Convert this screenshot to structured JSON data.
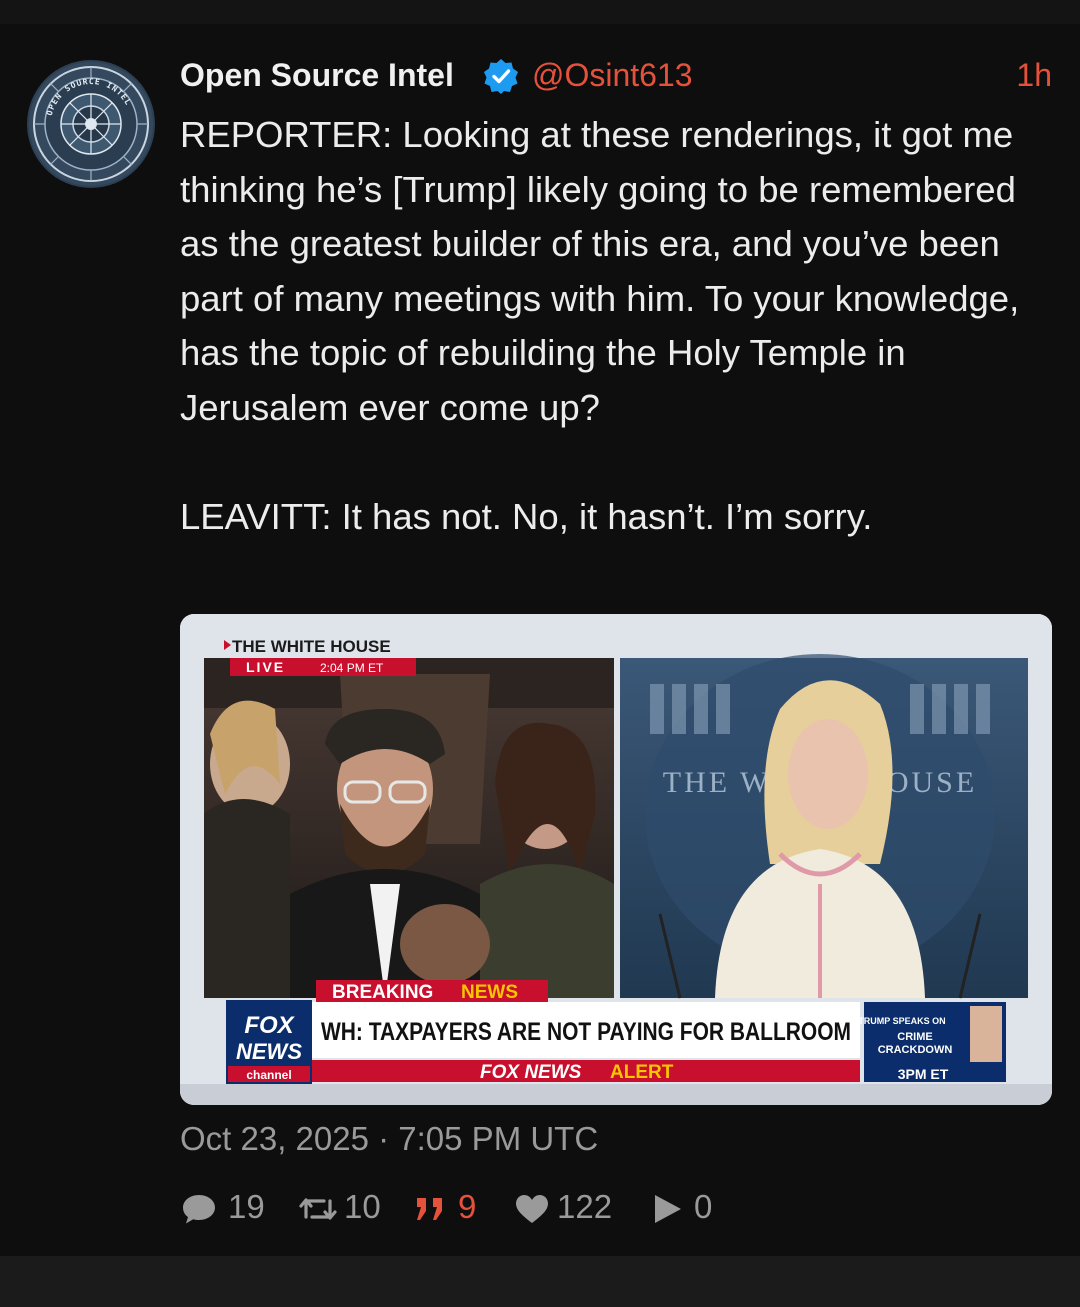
{
  "post": {
    "author_name": "Open Source Intel",
    "author_handle": "@Osint613",
    "time_ago": "1h",
    "verified": true,
    "avatar_logo_text": "OPEN SOURCE INTEL",
    "paragraphs": [
      "REPORTER: Looking at these renderings, it got me thinking he’s [Trump] likely going to be remembered as the greatest builder of this era, and you’ve been part of many meetings with him. To your knowledge, has the topic of rebuilding the Holy Temple in Jerusalem ever come up?",
      "LEAVITT: It has not. No, it hasn’t. I’m sorry."
    ],
    "timestamp": "Oct 23, 2025 · 7:05 PM UTC"
  },
  "media": {
    "bug_title": "THE WHITE HOUSE",
    "bug_live": "LIVE",
    "bug_time": "2:04 PM ET",
    "backdrop_text": "THE WHITE HOUSE",
    "breaking_word1": "BREAKING",
    "breaking_word2": "NEWS",
    "headline": "WH: TAXPAYERS ARE NOT PAYING FOR BALLROOM",
    "alert_word1": "FOX NEWS",
    "alert_word2": "ALERT",
    "logo_line1": "FOX",
    "logo_line2": "NEWS",
    "logo_line3": "channel",
    "promo_line1": "TRUMP SPEAKS ON",
    "promo_line2": "CRIME",
    "promo_line3": "CRACKDOWN",
    "promo_time": "3PM ET"
  },
  "stats": {
    "replies": "19",
    "retweets": "10",
    "quotes": "9",
    "likes": "122",
    "views": "0"
  },
  "colors": {
    "accent": "#e4523c",
    "verified_badge": "#1d9bf0",
    "text": "#ececec",
    "muted": "#9a9a9a",
    "background": "#0e0e0e",
    "fox_red": "#c8102e",
    "fox_navy": "#0b2d6b",
    "fox_yellow": "#f7c600"
  },
  "icons": {
    "reply": "speech-bubble-icon",
    "retweet": "retweet-icon",
    "quote": "quote-icon",
    "like": "heart-icon",
    "views": "play-icon",
    "verified": "verified-badge-icon"
  }
}
